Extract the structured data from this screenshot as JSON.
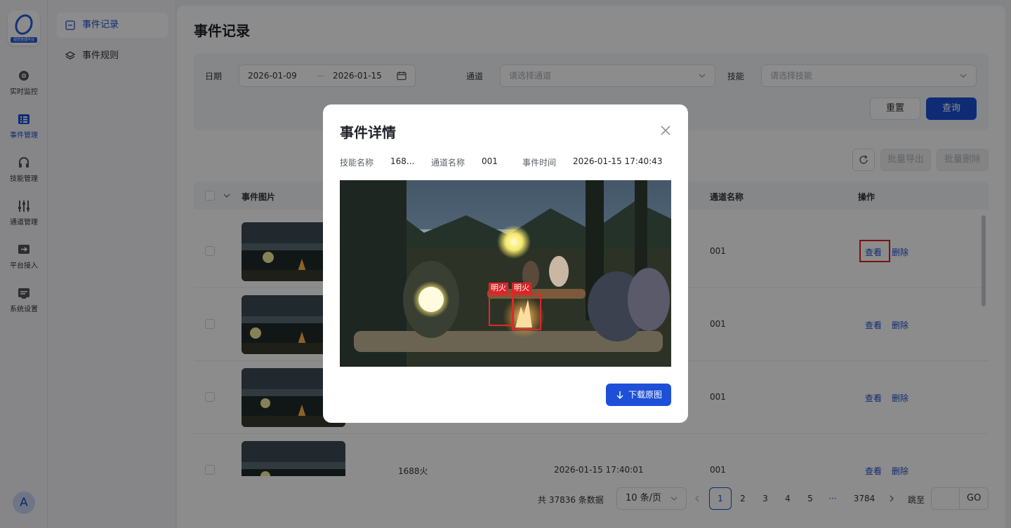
{
  "app": {
    "logo_text": "视觉管理平台",
    "avatar_letter": "A"
  },
  "rail": [
    {
      "label": "实时监控",
      "icon": "monitor-camera-icon"
    },
    {
      "label": "事件管理",
      "icon": "event-list-icon"
    },
    {
      "label": "技能管理",
      "icon": "headset-icon"
    },
    {
      "label": "通道管理",
      "icon": "sliders-icon"
    },
    {
      "label": "平台接入",
      "icon": "access-arrow-icon"
    },
    {
      "label": "系统设置",
      "icon": "server-icon"
    }
  ],
  "submenu": [
    {
      "label": "事件记录",
      "icon": "record-icon"
    },
    {
      "label": "事件规则",
      "icon": "layers-icon"
    }
  ],
  "page": {
    "title": "事件记录"
  },
  "filter": {
    "date_label": "日期",
    "date_start": "2026-01-09",
    "date_sep": "—",
    "date_end": "2026-01-15",
    "channel_label": "通道",
    "channel_placeholder": "请选择通道",
    "skill_label": "技能",
    "skill_placeholder": "请选择技能",
    "reset_label": "重置",
    "search_label": "查询"
  },
  "toolbar": {
    "export_label": "批量导出",
    "delete_label": "批量删除"
  },
  "table": {
    "headers": [
      "事件图片",
      "通道名称",
      "操作"
    ],
    "view_label": "查看",
    "delete_label": "删除",
    "rows": [
      {
        "skill": "",
        "time": "",
        "channel": "001"
      },
      {
        "skill": "",
        "time": "",
        "channel": "001"
      },
      {
        "skill": "",
        "time": "",
        "channel": "001"
      },
      {
        "skill": "1688火",
        "time": "2026-01-15 17:40:01",
        "channel": "001"
      }
    ]
  },
  "pagination": {
    "total_text": "共 37836 条数据",
    "page_size": "10 条/页",
    "pages": [
      "1",
      "2",
      "3",
      "4",
      "5",
      "···",
      "3784"
    ],
    "current_page": "1",
    "jump_label": "跳至",
    "go_label": "GO"
  },
  "modal": {
    "title": "事件详情",
    "skill_key": "技能名称",
    "skill_value": "168...",
    "channel_key": "通道名称",
    "channel_value": "001",
    "time_key": "事件时间",
    "time_value": "2026-01-15 17:40:43",
    "detections": [
      "明火",
      "明火"
    ],
    "download_label": "下载原图"
  },
  "colors": {
    "primary": "#1d4fd8",
    "detection": "#e02828",
    "highlight": "#e02020"
  }
}
